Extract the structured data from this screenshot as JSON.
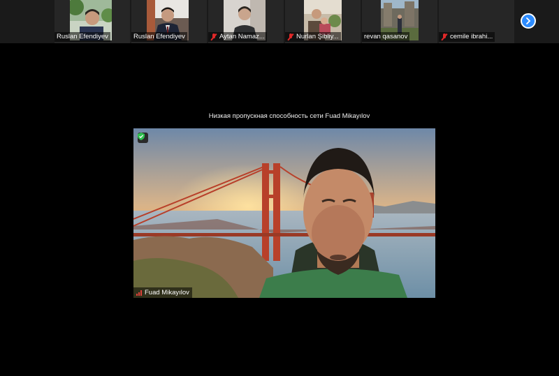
{
  "participants": [
    {
      "name": "Ruslan Efendiyev",
      "muted": false
    },
    {
      "name": "Ruslan Efendiyev",
      "muted": false
    },
    {
      "name": "Aytan Namaz...",
      "muted": true
    },
    {
      "name": "Nurlan Şibliy...",
      "muted": true
    },
    {
      "name": "revan qasanov",
      "muted": false
    },
    {
      "name": "cemile ibrahi...",
      "muted": true
    }
  ],
  "network_status": "Низкая пропускная способность сети Fuad Mikayılov",
  "active_speaker": {
    "name": "Fuad Mikayılov"
  },
  "icons": {
    "next": "chevron-right-icon",
    "encryption": "shield-check-icon",
    "signal": "signal-bars-icon",
    "muted": "mic-muted-icon"
  },
  "colors": {
    "accent": "#2d8cff",
    "muted": "#e02828",
    "encryption": "#2fbf4f",
    "signal": "#e0413a"
  }
}
